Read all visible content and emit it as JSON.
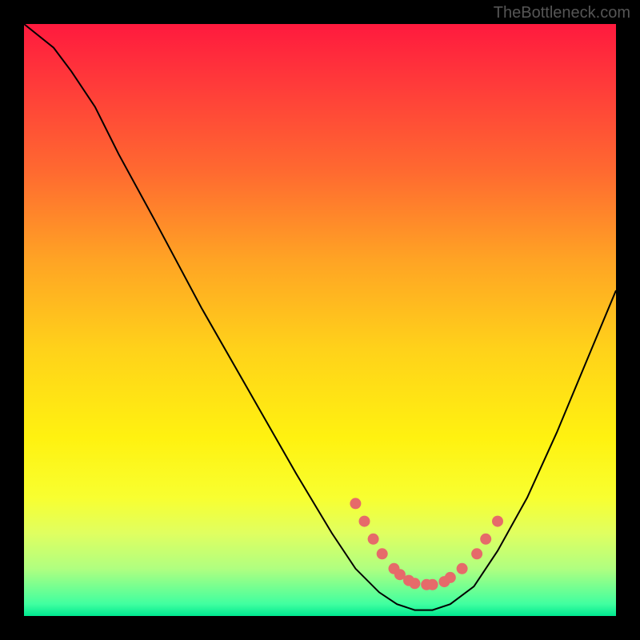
{
  "attribution": "TheBottleneck.com",
  "chart_data": {
    "type": "line",
    "title": "",
    "xlabel": "",
    "ylabel": "",
    "xlim": [
      0,
      100
    ],
    "ylim": [
      0,
      100
    ],
    "series": [
      {
        "name": "bottleneck-curve",
        "x": [
          0,
          5,
          8,
          12,
          16,
          22,
          30,
          38,
          46,
          52,
          56,
          60,
          63,
          66,
          69,
          72,
          76,
          80,
          85,
          90,
          95,
          100
        ],
        "y": [
          100,
          96,
          92,
          86,
          78,
          67,
          52,
          38,
          24,
          14,
          8,
          4,
          2,
          1,
          1,
          2,
          5,
          11,
          20,
          31,
          43,
          55
        ]
      }
    ],
    "markers": {
      "name": "highlighted-points",
      "x": [
        56,
        57.5,
        59,
        60.5,
        62.5,
        63.5,
        65,
        66,
        68,
        69,
        71,
        72,
        74,
        76.5,
        78,
        80
      ],
      "y": [
        19,
        16,
        13,
        10.5,
        8,
        7,
        6,
        5.5,
        5.3,
        5.3,
        5.8,
        6.5,
        8,
        10.5,
        13,
        16
      ]
    }
  }
}
